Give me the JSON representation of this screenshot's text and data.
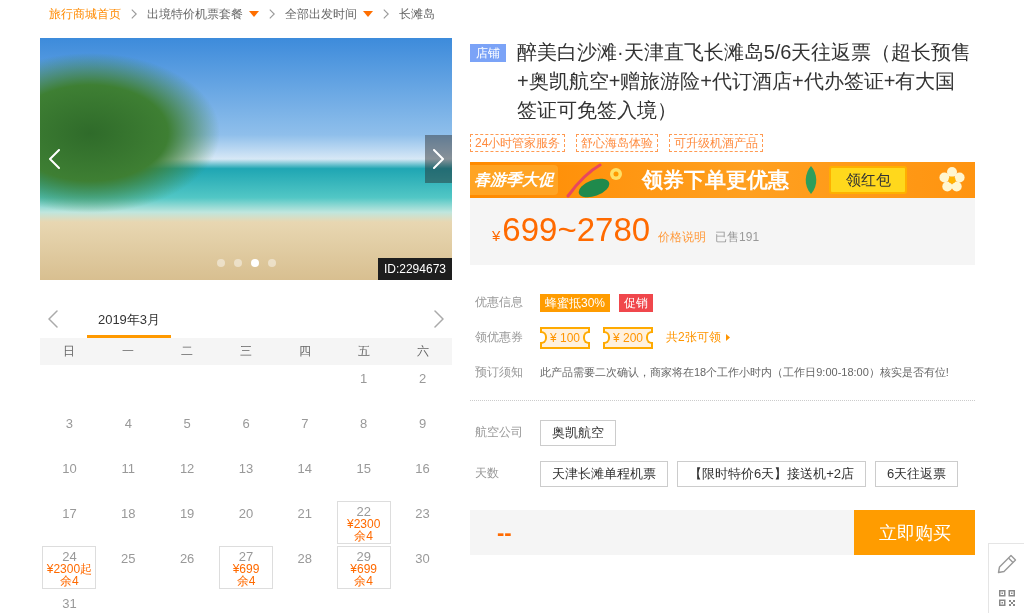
{
  "breadcrumb": [
    {
      "label": "旅行商城首页",
      "kind": "home"
    },
    {
      "label": "出境特价机票套餐",
      "kind": "menu"
    },
    {
      "label": "全部出发时间",
      "kind": "menu"
    },
    {
      "label": "长滩岛",
      "kind": "current"
    }
  ],
  "gallery": {
    "dots": [
      {
        "selected": false
      },
      {
        "selected": false
      },
      {
        "selected": true
      },
      {
        "selected": false
      }
    ],
    "id_label": "ID:2294673"
  },
  "calendar": {
    "months": [
      {
        "label": "2019年3月",
        "selected": true
      }
    ],
    "weekdays": [
      "日",
      "一",
      "二",
      "三",
      "四",
      "五",
      "六"
    ],
    "weeks": [
      {
        "kind": "leading",
        "days": [
          {
            "day": "1"
          },
          {
            "day": "2"
          }
        ]
      },
      {
        "kind": "full",
        "days": [
          {
            "day": "3"
          },
          {
            "day": "4"
          },
          {
            "day": "5"
          },
          {
            "day": "6"
          },
          {
            "day": "7"
          },
          {
            "day": "8"
          },
          {
            "day": "9"
          }
        ]
      },
      {
        "kind": "full",
        "days": [
          {
            "day": "10"
          },
          {
            "day": "11"
          },
          {
            "day": "12"
          },
          {
            "day": "13"
          },
          {
            "day": "14"
          },
          {
            "day": "15"
          },
          {
            "day": "16"
          }
        ]
      },
      {
        "kind": "full",
        "days": [
          {
            "day": "17"
          },
          {
            "day": "18"
          },
          {
            "day": "19"
          },
          {
            "day": "20"
          },
          {
            "day": "21"
          },
          {
            "day": "22",
            "price": "¥2300",
            "stock": "余4"
          },
          {
            "day": "23"
          }
        ]
      },
      {
        "kind": "full",
        "days": [
          {
            "day": "24",
            "price": "¥2300起",
            "stock": "余4"
          },
          {
            "day": "25"
          },
          {
            "day": "26"
          },
          {
            "day": "27",
            "price": "¥699",
            "stock": "余4"
          },
          {
            "day": "28"
          },
          {
            "day": "29",
            "price": "¥699",
            "stock": "余4"
          },
          {
            "day": "30"
          }
        ]
      },
      {
        "kind": "trailing",
        "days": [
          {
            "day": "31"
          }
        ]
      }
    ]
  },
  "product": {
    "shop_badge": "店铺",
    "title": "醉美白沙滩·天津直飞长滩岛5/6天往返票（超长预售+奥凯航空+赠旅游险+代订酒店+代办签证+有大国签证可免签入境）",
    "tags": [
      "24小时管家服务",
      "舒心海岛体验",
      "可升级机酒产品"
    ]
  },
  "banner": {
    "tagline": "春游季大促",
    "headline": "领券下单更优惠",
    "button": "领红包"
  },
  "price": {
    "currency": "¥",
    "range": "699~2780",
    "note_link": "价格说明",
    "sold": "已售191"
  },
  "promotions": {
    "label": "优惠信息",
    "badges": [
      {
        "text": "蜂蜜抵30%",
        "color": "#ff9c00"
      },
      {
        "text": "促销",
        "color": "#f0474c"
      }
    ]
  },
  "coupons": {
    "label": "领优惠券",
    "items": [
      "¥ 100",
      "¥ 200"
    ],
    "more_link": "共2张可领"
  },
  "notice": {
    "label": "预订须知",
    "text": "此产品需要二次确认，商家将在18个工作小时内（工作日9:00-18:00）核实是否有位!"
  },
  "options": [
    {
      "label": "航空公司",
      "choices": [
        {
          "label": "奥凯航空",
          "selected": false
        }
      ]
    },
    {
      "label": "天数",
      "choices": [
        {
          "label": "天津长滩单程机票",
          "selected": false
        },
        {
          "label": "【限时特价6天】接送机+2店",
          "selected": false
        },
        {
          "label": "6天往返票",
          "selected": false
        }
      ]
    }
  ],
  "purchase": {
    "total": "--",
    "button": "立即购买"
  }
}
